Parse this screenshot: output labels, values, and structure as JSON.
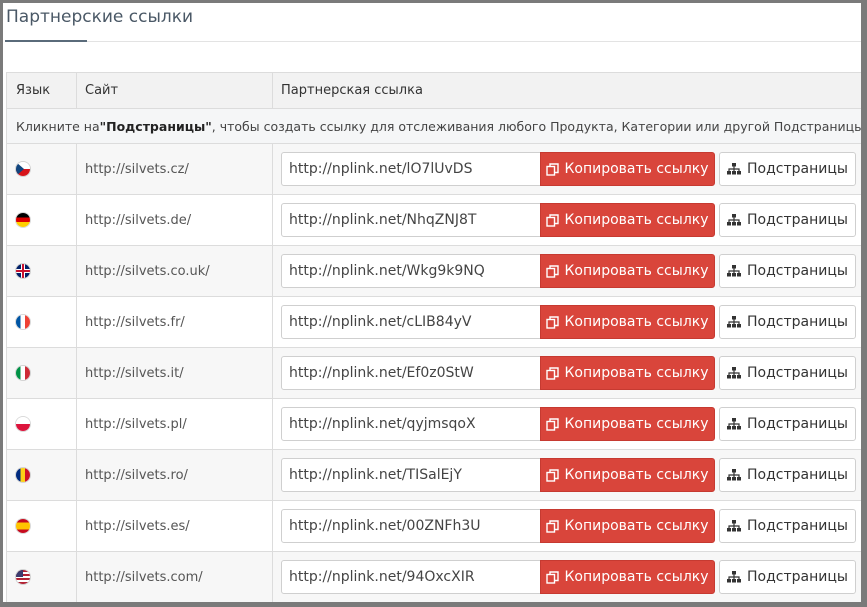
{
  "page": {
    "title": "Партнерские ссылки"
  },
  "table": {
    "col_lang": "Язык",
    "col_site": "Сайт",
    "col_link": "Партнерская ссылка",
    "info_prefix": "Кликните на ",
    "info_bold": "\"Подстраницы\"",
    "info_suffix": ", чтобы создать ссылку для отслеживания любого Продукта, Категории или другой Подстраницы.",
    "copy_label": "Копировать ссылку",
    "sub_label": "Подстраницы",
    "rows": [
      {
        "flag": "cz",
        "site": "http://silvets.cz/",
        "link": "http://nplink.net/lO7lUvDS"
      },
      {
        "flag": "de",
        "site": "http://silvets.de/",
        "link": "http://nplink.net/NhqZNJ8T"
      },
      {
        "flag": "uk",
        "site": "http://silvets.co.uk/",
        "link": "http://nplink.net/Wkg9k9NQ"
      },
      {
        "flag": "fr",
        "site": "http://silvets.fr/",
        "link": "http://nplink.net/cLIB84yV"
      },
      {
        "flag": "it",
        "site": "http://silvets.it/",
        "link": "http://nplink.net/Ef0z0StW"
      },
      {
        "flag": "pl",
        "site": "http://silvets.pl/",
        "link": "http://nplink.net/qyjmsqoX"
      },
      {
        "flag": "ro",
        "site": "http://silvets.ro/",
        "link": "http://nplink.net/TISalEjY"
      },
      {
        "flag": "es",
        "site": "http://silvets.es/",
        "link": "http://nplink.net/00ZNFh3U"
      },
      {
        "flag": "us",
        "site": "http://silvets.com/",
        "link": "http://nplink.net/94OxcXIR"
      }
    ]
  },
  "colors": {
    "copy_button": "#d9453b",
    "title": "#4a5866"
  }
}
